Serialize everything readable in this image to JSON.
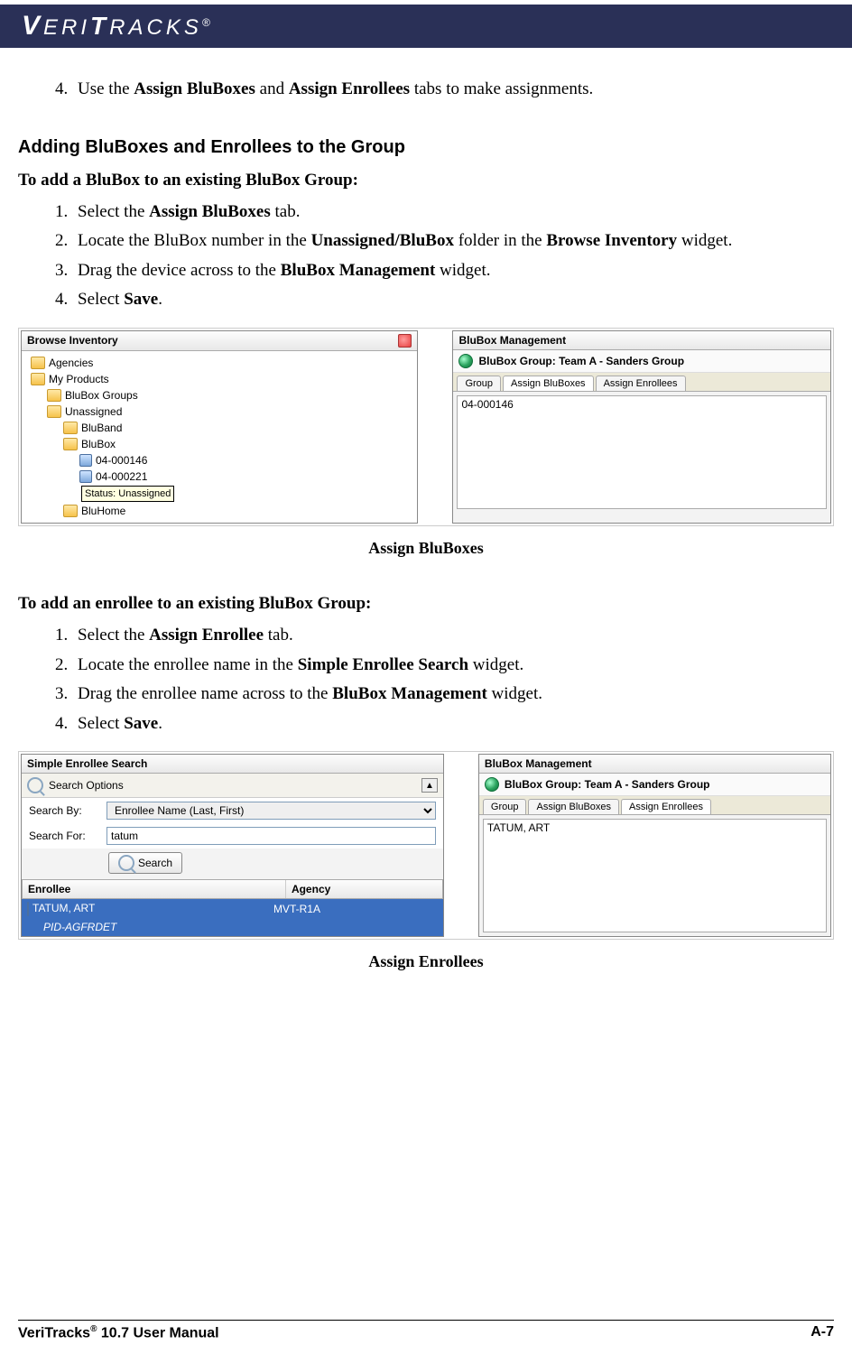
{
  "header": {
    "logo": "VERITRACKS",
    "registered": "®"
  },
  "top_step": {
    "num": "4.",
    "pre": "Use the ",
    "b1": "Assign BluBoxes",
    "mid": " and ",
    "b2": "Assign Enrollees",
    "post": " tabs to make assignments."
  },
  "section_heading": "Adding BluBoxes and Enrollees to the Group",
  "proc1": {
    "heading": "To add a BluBox to an existing BluBox Group:",
    "steps": [
      {
        "pre": "Select the ",
        "b1": "Assign BluBoxes",
        "post": " tab."
      },
      {
        "pre": "Locate the BluBox number in the ",
        "b1": "Unassigned/BluBox",
        "mid": " folder in the ",
        "b2": "Browse Inventory",
        "post": " widget."
      },
      {
        "pre": "Drag the device across to the ",
        "b1": "BluBox Management",
        "post": " widget."
      },
      {
        "pre": "Select ",
        "b1": "Save",
        "post": "."
      }
    ],
    "caption": "Assign BluBoxes"
  },
  "proc2": {
    "heading": "To add an enrollee to an existing BluBox Group:",
    "steps": [
      {
        "pre": "Select the ",
        "b1": "Assign Enrollee",
        "post": " tab."
      },
      {
        "pre": "Locate the enrollee name in the ",
        "b1": "Simple Enrollee Search",
        "post": " widget."
      },
      {
        "pre": "Drag the enrollee name across to the ",
        "b1": "BluBox Management",
        "post": " widget."
      },
      {
        "pre": "Select ",
        "b1": "Save",
        "post": "."
      }
    ],
    "caption": "Assign Enrollees"
  },
  "shot1": {
    "left": {
      "title": "Browse Inventory",
      "tree": [
        {
          "indent": 0,
          "icon": "folder",
          "label": "Agencies"
        },
        {
          "indent": 0,
          "icon": "folder",
          "label": "My Products"
        },
        {
          "indent": 1,
          "icon": "folder",
          "label": "BluBox Groups"
        },
        {
          "indent": 1,
          "icon": "folder",
          "label": "Unassigned"
        },
        {
          "indent": 2,
          "icon": "folder",
          "label": "BluBand"
        },
        {
          "indent": 2,
          "icon": "folder",
          "label": "BluBox"
        },
        {
          "indent": 3,
          "icon": "device",
          "label": "04-000146"
        },
        {
          "indent": 3,
          "icon": "device",
          "label": "04-000221"
        },
        {
          "indent": 2,
          "icon": "folder",
          "label": "BluHome"
        }
      ],
      "tooltip": "Status: Unassigned"
    },
    "right": {
      "title": "BluBox Management",
      "group_label_prefix": "BluBox Group:  ",
      "group_name": "Team A - Sanders Group",
      "tabs": [
        "Group",
        "Assign BluBoxes",
        "Assign Enrollees"
      ],
      "active_tab": 1,
      "list": [
        "04-000146"
      ]
    }
  },
  "shot2": {
    "left": {
      "title": "Simple Enrollee Search",
      "options_label": "Search Options",
      "search_by_label": "Search By:",
      "search_by_value": "Enrollee Name (Last, First)",
      "search_for_label": "Search For:",
      "search_for_value": "tatum",
      "search_btn": "Search",
      "columns": [
        "Enrollee",
        "Agency"
      ],
      "result_name": "TATUM, ART",
      "result_pid": "PID-AGFRDET",
      "result_agency": "MVT-R1A"
    },
    "right": {
      "title": "BluBox Management",
      "group_label_prefix": "BluBox Group:  ",
      "group_name": "Team A - Sanders Group",
      "tabs": [
        "Group",
        "Assign BluBoxes",
        "Assign Enrollees"
      ],
      "active_tab": 2,
      "list": [
        "TATUM, ART"
      ]
    }
  },
  "footer": {
    "manual": "VeriTracks",
    "manual_sup": "®",
    "manual_rest": " 10.7 User Manual",
    "page": "A-7"
  }
}
